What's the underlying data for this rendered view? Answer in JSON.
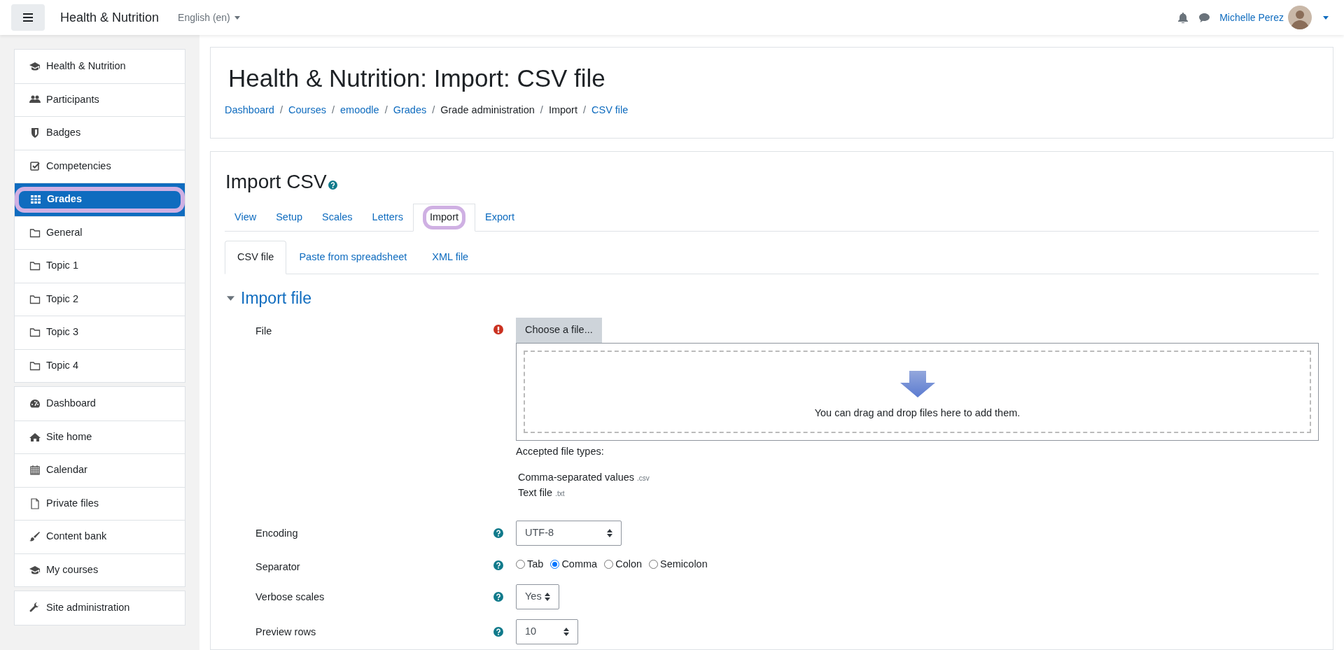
{
  "navbar": {
    "site_name": "Health & Nutrition",
    "language": "English (en)",
    "user_name": "Michelle Perez"
  },
  "sidebar": {
    "groups": [
      [
        {
          "label": "Health & Nutrition",
          "selected": false,
          "highlighted": false
        },
        {
          "label": "Participants",
          "selected": false,
          "highlighted": false
        },
        {
          "label": "Badges",
          "selected": false,
          "highlighted": false
        },
        {
          "label": "Competencies",
          "selected": false,
          "highlighted": false
        },
        {
          "label": "Grades",
          "selected": true,
          "highlighted": true
        },
        {
          "label": "General",
          "selected": false,
          "highlighted": false
        },
        {
          "label": "Topic 1",
          "selected": false,
          "highlighted": false
        },
        {
          "label": "Topic 2",
          "selected": false,
          "highlighted": false
        },
        {
          "label": "Topic 3",
          "selected": false,
          "highlighted": false
        },
        {
          "label": "Topic 4",
          "selected": false,
          "highlighted": false
        }
      ],
      [
        {
          "label": "Dashboard",
          "selected": false,
          "highlighted": false
        },
        {
          "label": "Site home",
          "selected": false,
          "highlighted": false
        },
        {
          "label": "Calendar",
          "selected": false,
          "highlighted": false
        },
        {
          "label": "Private files",
          "selected": false,
          "highlighted": false
        },
        {
          "label": "Content bank",
          "selected": false,
          "highlighted": false
        },
        {
          "label": "My courses",
          "selected": false,
          "highlighted": false
        }
      ],
      [
        {
          "label": "Site administration",
          "selected": false,
          "highlighted": false
        }
      ]
    ]
  },
  "page_header": {
    "title": "Health & Nutrition: Import: CSV file",
    "breadcrumbs": [
      {
        "label": "Dashboard",
        "link": true
      },
      {
        "separator": "/",
        "label": "Courses",
        "link": true
      },
      {
        "separator": "/",
        "label": "emoodle",
        "link": true
      },
      {
        "separator": "/",
        "label": "Grades",
        "link": true
      },
      {
        "separator": "/",
        "label": "Grade administration",
        "link": false
      },
      {
        "separator": "/",
        "label": "Import",
        "link": false
      },
      {
        "separator": "/",
        "label": "CSV file",
        "link": true
      }
    ]
  },
  "content": {
    "title": "Import CSV",
    "tabs": [
      {
        "label": "View",
        "selected": false,
        "highlighted": false
      },
      {
        "label": "Setup",
        "selected": false,
        "highlighted": false
      },
      {
        "label": "Scales",
        "selected": false,
        "highlighted": false
      },
      {
        "label": "Letters",
        "selected": false,
        "highlighted": false
      },
      {
        "label": "Import",
        "selected": true,
        "highlighted": true
      },
      {
        "label": "Export",
        "selected": false,
        "highlighted": false
      }
    ],
    "subtabs": [
      {
        "label": "CSV file",
        "selected": true
      },
      {
        "label": "Paste from spreadsheet",
        "selected": false
      },
      {
        "label": "XML file",
        "selected": false
      }
    ],
    "section": {
      "title": "Import file",
      "expanded": true
    },
    "file": {
      "label": "File",
      "required": true,
      "button": "Choose a file...",
      "drop_text": "You can drag and drop files here to add them.",
      "accepted_label": "Accepted file types:",
      "types": [
        {
          "name": "Comma-separated values",
          "ext": ".csv"
        },
        {
          "name": "Text file",
          "ext": ".txt"
        }
      ]
    },
    "fields": [
      {
        "kind": "select",
        "label": "Encoding",
        "value": "UTF-8"
      },
      {
        "kind": "radio",
        "label": "Separator",
        "options": [
          {
            "label": "Tab",
            "selected": false
          },
          {
            "label": "Comma",
            "selected": true
          },
          {
            "label": "Colon",
            "selected": false
          },
          {
            "label": "Semicolon",
            "selected": false
          }
        ]
      },
      {
        "kind": "select",
        "label": "Verbose scales",
        "value": "Yes"
      },
      {
        "kind": "select",
        "label": "Preview rows",
        "value": "10"
      }
    ]
  }
}
